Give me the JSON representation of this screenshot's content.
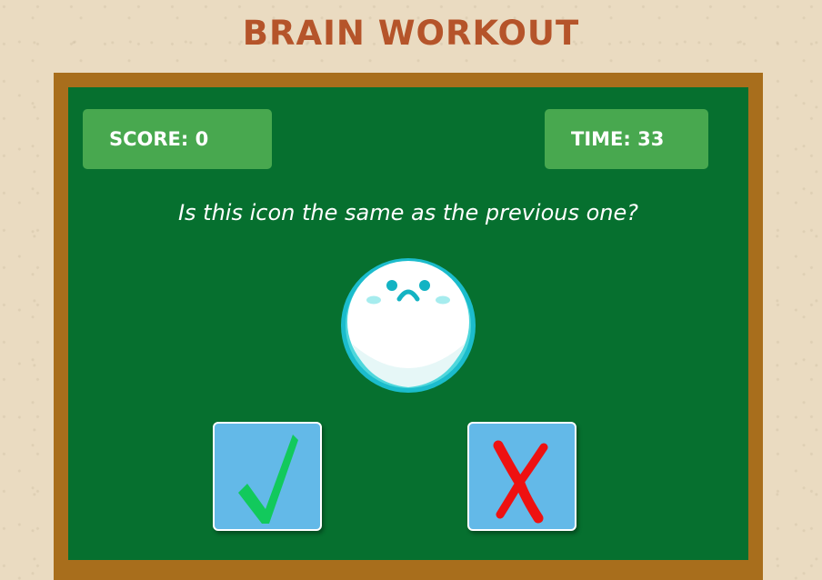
{
  "title": "BRAIN WORKOUT",
  "hud": {
    "score_text": "SCORE: 0",
    "time_text": "TIME: 33"
  },
  "question": "Is this icon the same as the previous one?",
  "current_icon": {
    "name": "sad-face-ball-icon",
    "outline_color": "#1bbccc",
    "face_color": "#ffffff"
  },
  "answers": {
    "yes_icon": "check-mark-icon",
    "no_icon": "red-x-icon"
  },
  "colors": {
    "background": "#eadbc1",
    "title": "#b5542a",
    "frame": "#a86e1c",
    "board": "#06702f",
    "hud_box": "#48a84f",
    "answer_button": "#63b9e8",
    "check": "#12c95c",
    "cross": "#ee1111"
  }
}
